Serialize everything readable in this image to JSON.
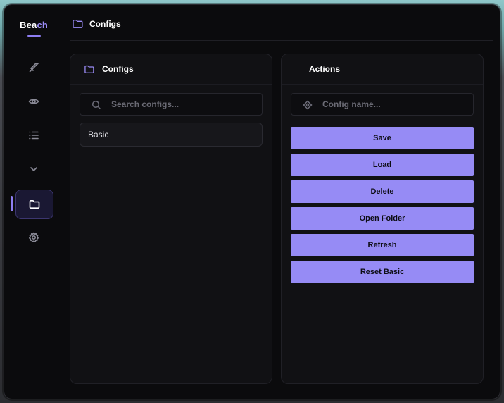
{
  "brand": {
    "prefix": "Bea",
    "accent": "ch"
  },
  "topbar": {
    "title": "Configs",
    "icon": "folder-icon"
  },
  "sidebar": {
    "items": [
      {
        "name": "combat",
        "icon": "sword-icon"
      },
      {
        "name": "visuals",
        "icon": "eye-icon"
      },
      {
        "name": "list",
        "icon": "list-icon"
      },
      {
        "name": "collapse",
        "icon": "chevron-down-icon"
      },
      {
        "name": "configs",
        "icon": "folder-icon",
        "active": true
      },
      {
        "name": "settings",
        "icon": "gear-icon"
      }
    ]
  },
  "configs_panel": {
    "title": "Configs",
    "search_placeholder": "Search configs...",
    "items": [
      {
        "label": "Basic"
      }
    ]
  },
  "actions_panel": {
    "title": "Actions",
    "name_placeholder": "Config name...",
    "buttons": [
      {
        "label": "Save"
      },
      {
        "label": "Load"
      },
      {
        "label": "Delete"
      },
      {
        "label": "Open Folder"
      },
      {
        "label": "Refresh"
      },
      {
        "label": "Reset Basic"
      }
    ]
  },
  "colors": {
    "accent": "#968bf5",
    "background": "#0b0b0d",
    "panel": "#111114"
  }
}
